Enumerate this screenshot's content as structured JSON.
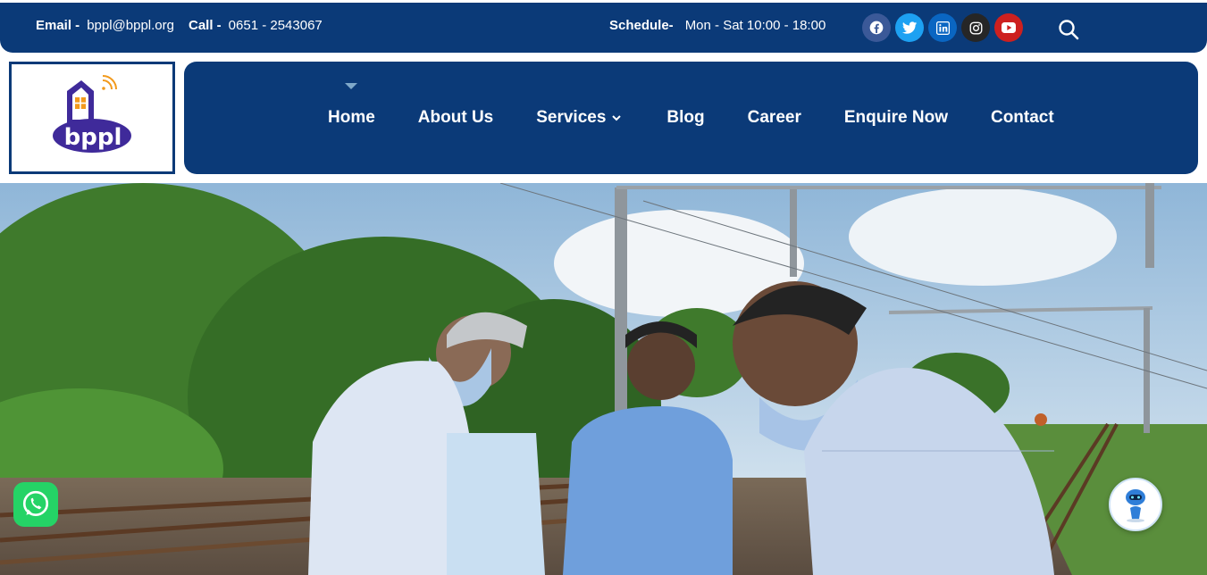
{
  "topbar": {
    "email_label": "Email -",
    "email_value": "bppl@bppl.org",
    "call_label": "Call -",
    "call_value": "0651 - 2543067",
    "schedule_label": "Schedule-",
    "schedule_value": "Mon - Sat 10:00 - 18:00",
    "social": [
      {
        "icon": "facebook-icon",
        "color": "#3b5998"
      },
      {
        "icon": "twitter-icon",
        "color": "#1da1f2"
      },
      {
        "icon": "linkedin-icon",
        "color": "#0a66c2"
      },
      {
        "icon": "instagram-icon",
        "color": "#262626"
      },
      {
        "icon": "youtube-icon",
        "color": "#cd201f"
      }
    ]
  },
  "logo": {
    "text": "bppl",
    "house_color": "#3f2a9a",
    "window_color": "#f29a1d"
  },
  "nav": {
    "items": [
      "Home",
      "About Us",
      "Services",
      "Blog",
      "Career",
      "Enquire Now",
      "Contact"
    ]
  },
  "colors": {
    "primary": "#0b3a78",
    "accent": "#7fa8c9",
    "whatsapp": "#25d366"
  }
}
